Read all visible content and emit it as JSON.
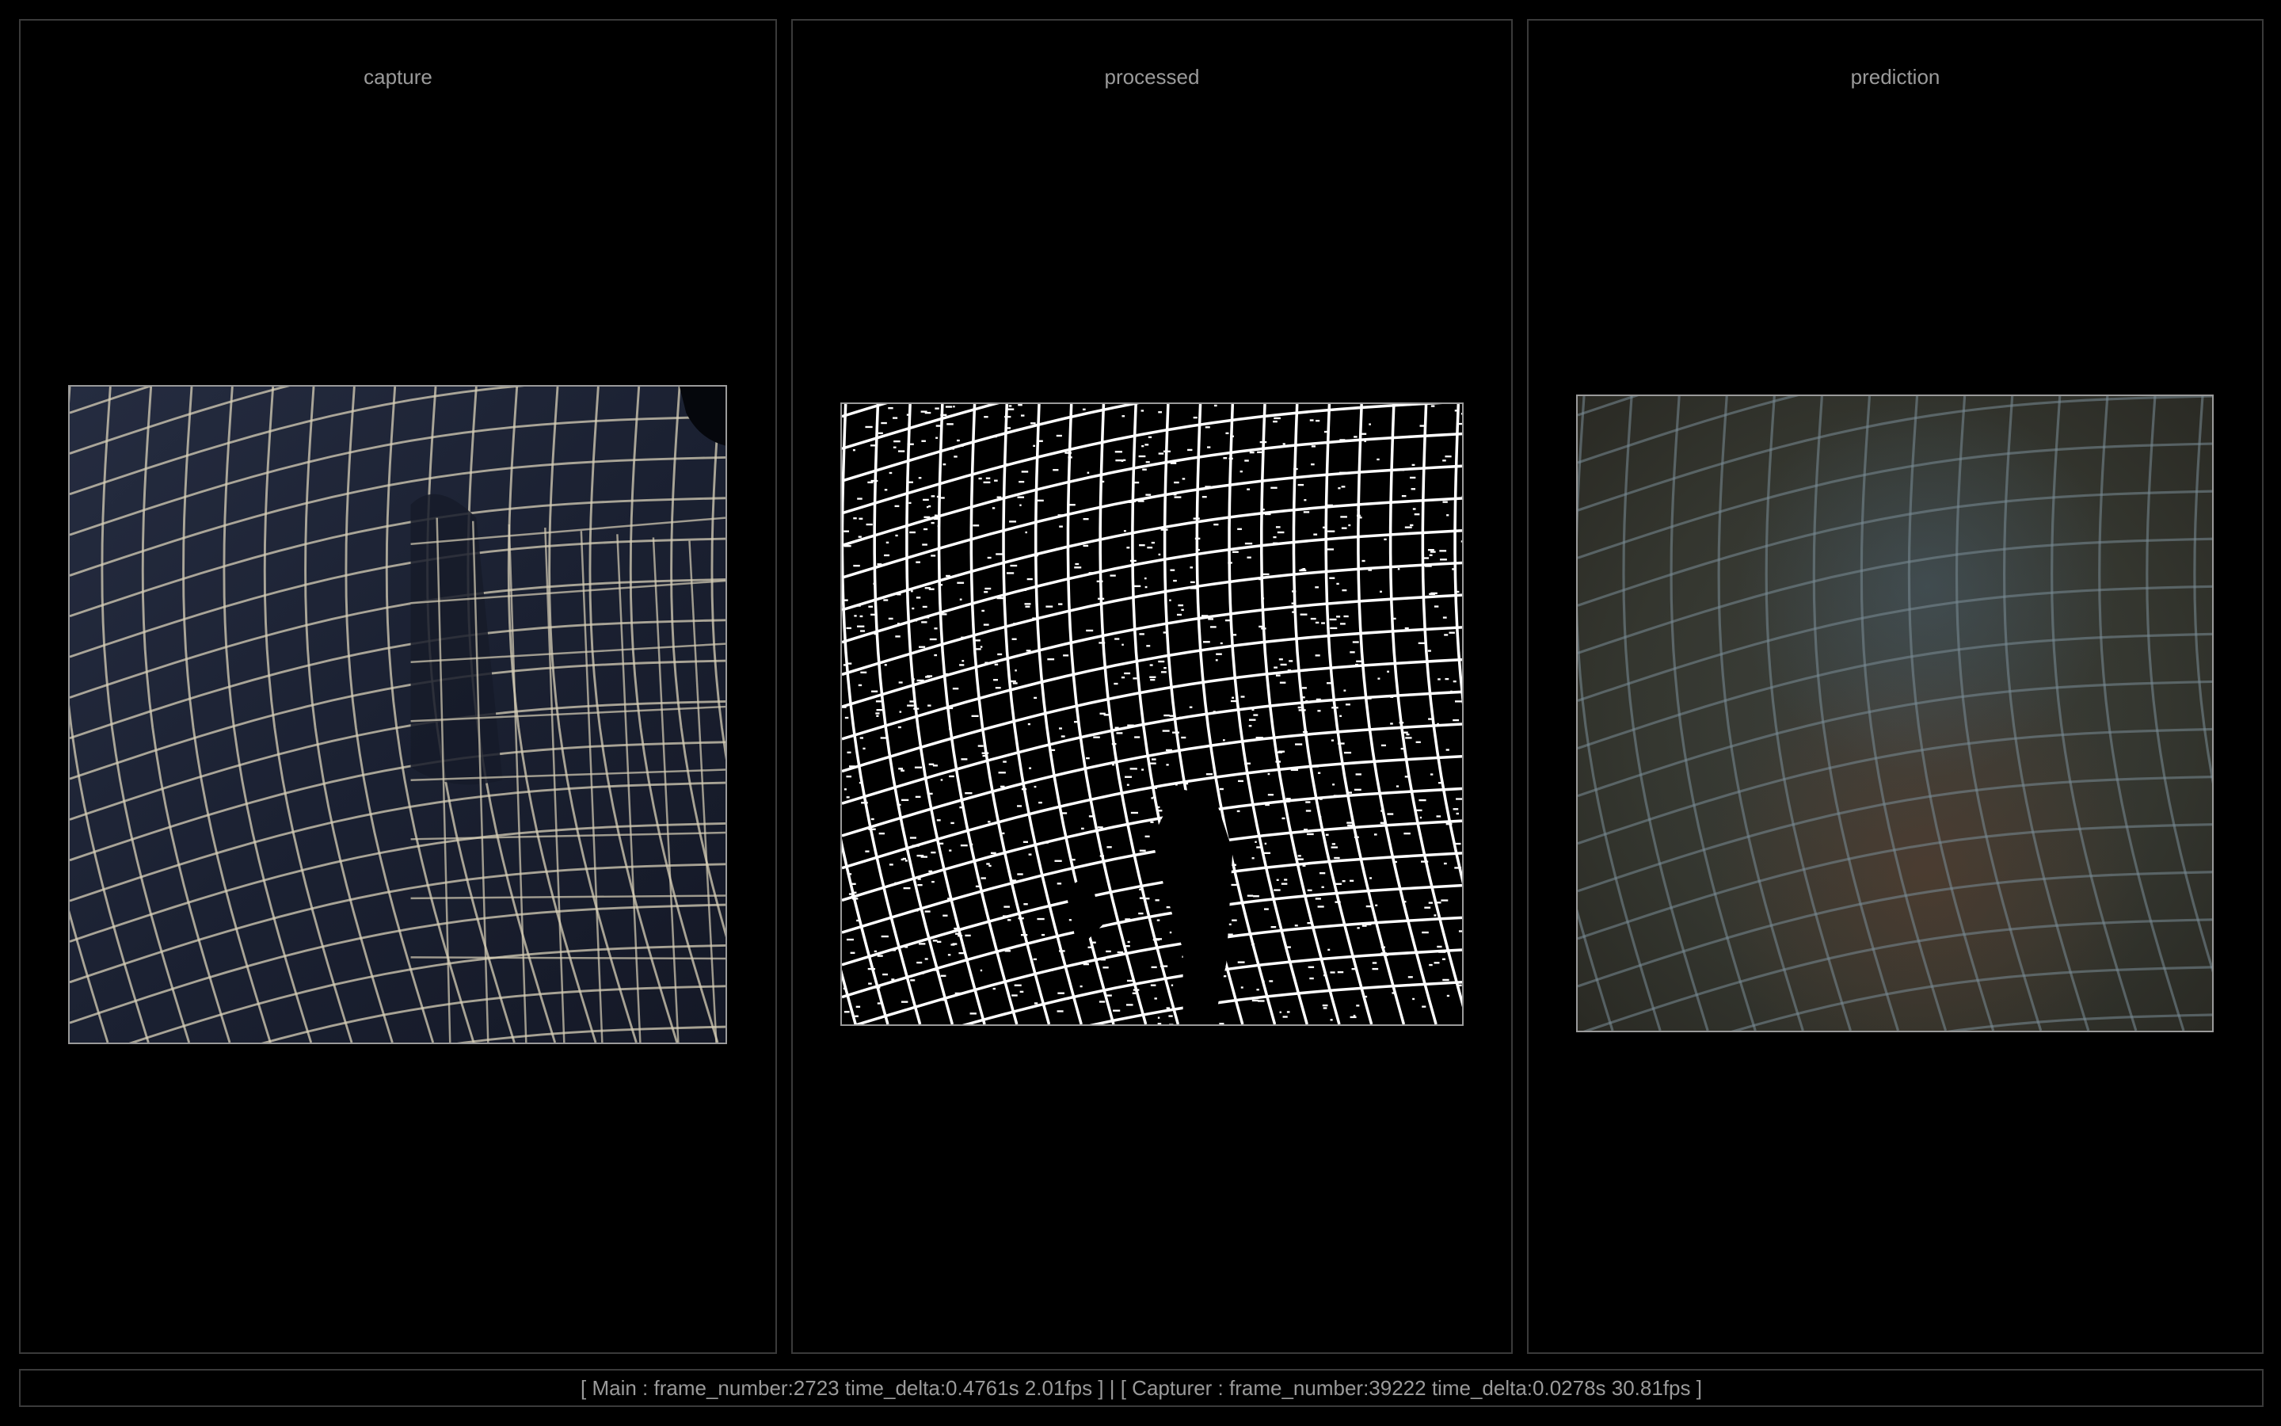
{
  "panels": {
    "capture": {
      "title": "capture"
    },
    "processed": {
      "title": "processed"
    },
    "prediction": {
      "title": "prediction"
    }
  },
  "colors": {
    "background": "#000000",
    "border": "#3a3a3a",
    "text": "#9a9a9a",
    "fabric": "#1c2233",
    "fabric_lines": "#d8d0b8",
    "edges": "#ffffff",
    "prediction_base": "#3a3a34",
    "prediction_lines": "#7a8c96"
  },
  "status": {
    "text": "[ Main : frame_number:2723 time_delta:0.4761s 2.01fps ] | [ Capturer : frame_number:39222 time_delta:0.0278s 30.81fps ]"
  }
}
